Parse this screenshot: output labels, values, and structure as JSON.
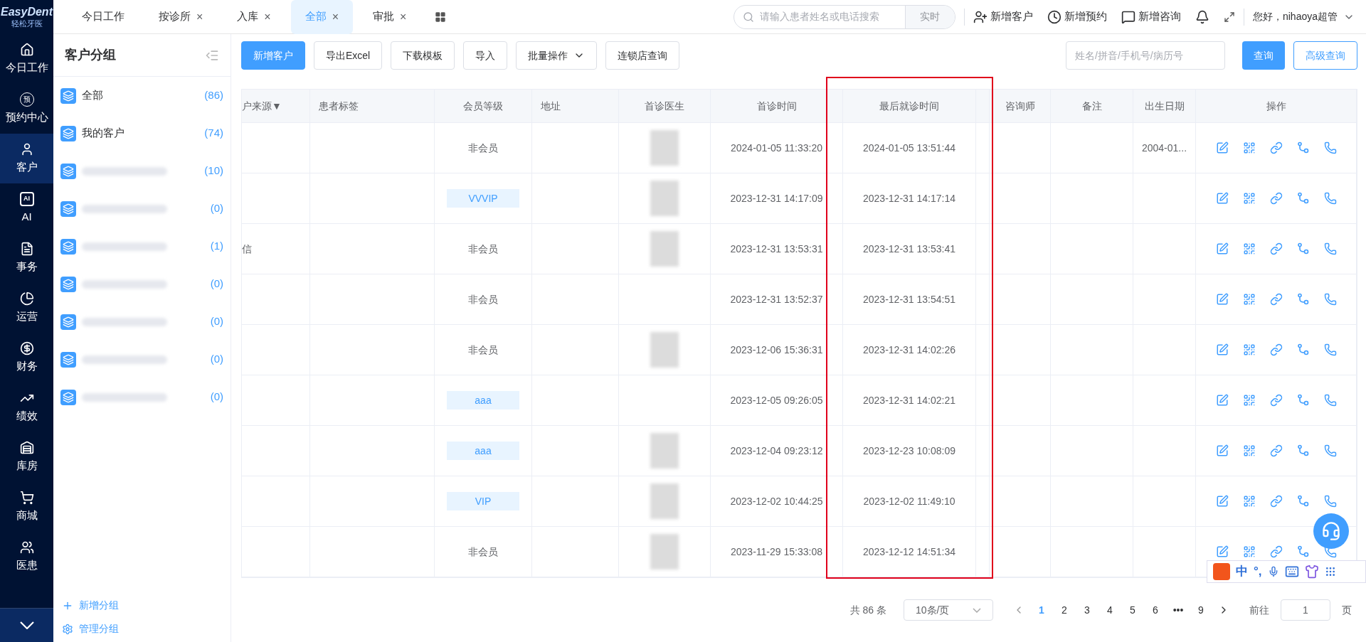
{
  "logo": {
    "name": "EasyDent",
    "subtitle": "轻松牙医"
  },
  "tabs": [
    {
      "label": "今日工作",
      "closable": false,
      "selected": false
    },
    {
      "label": "按诊所",
      "closable": true,
      "selected": false
    },
    {
      "label": "入库",
      "closable": true,
      "selected": false
    },
    {
      "label": "全部",
      "closable": true,
      "selected": true
    },
    {
      "label": "审批",
      "closable": true,
      "selected": false
    }
  ],
  "close_mark": "×",
  "header": {
    "search_placeholder": "请输入患者姓名或电话搜索",
    "search_button": "实时",
    "actions": [
      {
        "kind": "user-plus",
        "label": "新增客户"
      },
      {
        "kind": "clock-plus",
        "label": "新增预约"
      },
      {
        "kind": "message",
        "label": "新增咨询"
      }
    ],
    "greeting": "您好，nihaoya超管"
  },
  "nav": [
    {
      "kind": "home",
      "label": "今日工作",
      "selected": false
    },
    {
      "kind": "badge",
      "label": "预约中心",
      "glyph": "预",
      "selected": false
    },
    {
      "kind": "user",
      "label": "客户",
      "selected": true
    },
    {
      "kind": "chip",
      "label": "AI",
      "glyph": "AI",
      "selected": false
    },
    {
      "kind": "doc",
      "label": "事务",
      "selected": false
    },
    {
      "kind": "pie",
      "label": "运营",
      "selected": false
    },
    {
      "kind": "money",
      "label": "财务",
      "selected": false
    },
    {
      "kind": "chart",
      "label": "绩效",
      "selected": false
    },
    {
      "kind": "warehouse",
      "label": "库房",
      "selected": false
    },
    {
      "kind": "cart",
      "label": "商城",
      "selected": false
    },
    {
      "kind": "people",
      "label": "医患",
      "selected": false
    }
  ],
  "groups": {
    "title": "客户分组",
    "items": [
      {
        "name": "全部",
        "count": "(86)"
      },
      {
        "name": "我的客户",
        "count": "(74)"
      },
      {
        "redacted": true,
        "count": "(10)"
      },
      {
        "redacted": true,
        "count": "(0)"
      },
      {
        "redacted": true,
        "count": "(1)"
      },
      {
        "redacted": true,
        "count": "(0)"
      },
      {
        "redacted": true,
        "count": "(0)"
      },
      {
        "redacted": true,
        "count": "(0)"
      },
      {
        "redacted": true,
        "count": "(0)"
      }
    ],
    "add": "新增分组",
    "manage": "管理分组"
  },
  "toolbar": {
    "buttons": [
      {
        "label": "新增客户",
        "kind": "primary"
      },
      {
        "label": "导出Excel",
        "kind": "default"
      },
      {
        "label": "下载模板",
        "kind": "default"
      },
      {
        "label": "导入",
        "kind": "default"
      },
      {
        "label": "批量操作",
        "kind": "dropdown"
      },
      {
        "label": "连锁店查询",
        "kind": "default"
      }
    ],
    "search_placeholder": "姓名/拼音/手机号/病历号",
    "query": "查询",
    "advanced": "高级查询"
  },
  "table": {
    "columns": [
      "户来源▼",
      "患者标签",
      "会员等级",
      "地址",
      "首诊医生",
      "首诊时间",
      "最后就诊时间",
      "",
      "咨询师",
      "备注",
      "出生日期",
      "操作"
    ],
    "rows": [
      {
        "source": "",
        "level": {
          "text": "非会员",
          "kind": "plain"
        },
        "doctor_redacted": true,
        "first": "2024-01-05 11:33:20",
        "last": "2024-01-05 13:51:44",
        "birth": "2004-01..."
      },
      {
        "source": "",
        "level": {
          "text": "VVVIP",
          "kind": "tag"
        },
        "doctor_redacted": true,
        "first": "2023-12-31 14:17:09",
        "last": "2023-12-31 14:17:14",
        "birth": ""
      },
      {
        "source": "信",
        "level": {
          "text": "非会员",
          "kind": "plain"
        },
        "doctor_redacted": true,
        "first": "2023-12-31 13:53:31",
        "last": "2023-12-31 13:53:41",
        "birth": ""
      },
      {
        "source": "",
        "level": {
          "text": "非会员",
          "kind": "plain"
        },
        "doctor_redacted": false,
        "first": "2023-12-31 13:52:37",
        "last": "2023-12-31 13:54:51",
        "birth": ""
      },
      {
        "source": "",
        "level": {
          "text": "非会员",
          "kind": "plain"
        },
        "doctor_redacted": true,
        "first": "2023-12-06 15:36:31",
        "last": "2023-12-31 14:02:26",
        "birth": ""
      },
      {
        "source": "",
        "level": {
          "text": "aaa",
          "kind": "tag"
        },
        "doctor_redacted": false,
        "first": "2023-12-05 09:26:05",
        "last": "2023-12-31 14:02:21",
        "birth": ""
      },
      {
        "source": "",
        "level": {
          "text": "aaa",
          "kind": "tag"
        },
        "doctor_redacted": true,
        "first": "2023-12-04 09:23:12",
        "last": "2023-12-23 10:08:09",
        "birth": ""
      },
      {
        "source": "",
        "level": {
          "text": "VIP",
          "kind": "tag"
        },
        "doctor_redacted": true,
        "first": "2023-12-02 10:44:25",
        "last": "2023-12-02 11:49:10",
        "birth": ""
      },
      {
        "source": "",
        "level": {
          "text": "非会员",
          "kind": "plain"
        },
        "doctor_redacted": true,
        "first": "2023-11-29 15:33:08",
        "last": "2023-12-12 14:51:34",
        "birth": ""
      }
    ]
  },
  "pagination": {
    "total": "共 86 条",
    "page_size": "10条/页",
    "pages": [
      {
        "label": "1",
        "selected": true
      },
      {
        "label": "2",
        "selected": false
      },
      {
        "label": "3",
        "selected": false
      },
      {
        "label": "4",
        "selected": false
      },
      {
        "label": "5",
        "selected": false
      },
      {
        "label": "6",
        "selected": false
      },
      {
        "label": "•••",
        "selected": false
      },
      {
        "label": "9",
        "selected": false
      }
    ],
    "goto": "前往",
    "goto_value": "1",
    "page_unit": "页"
  },
  "ime": {
    "lang": "中",
    "punct": "°,"
  }
}
